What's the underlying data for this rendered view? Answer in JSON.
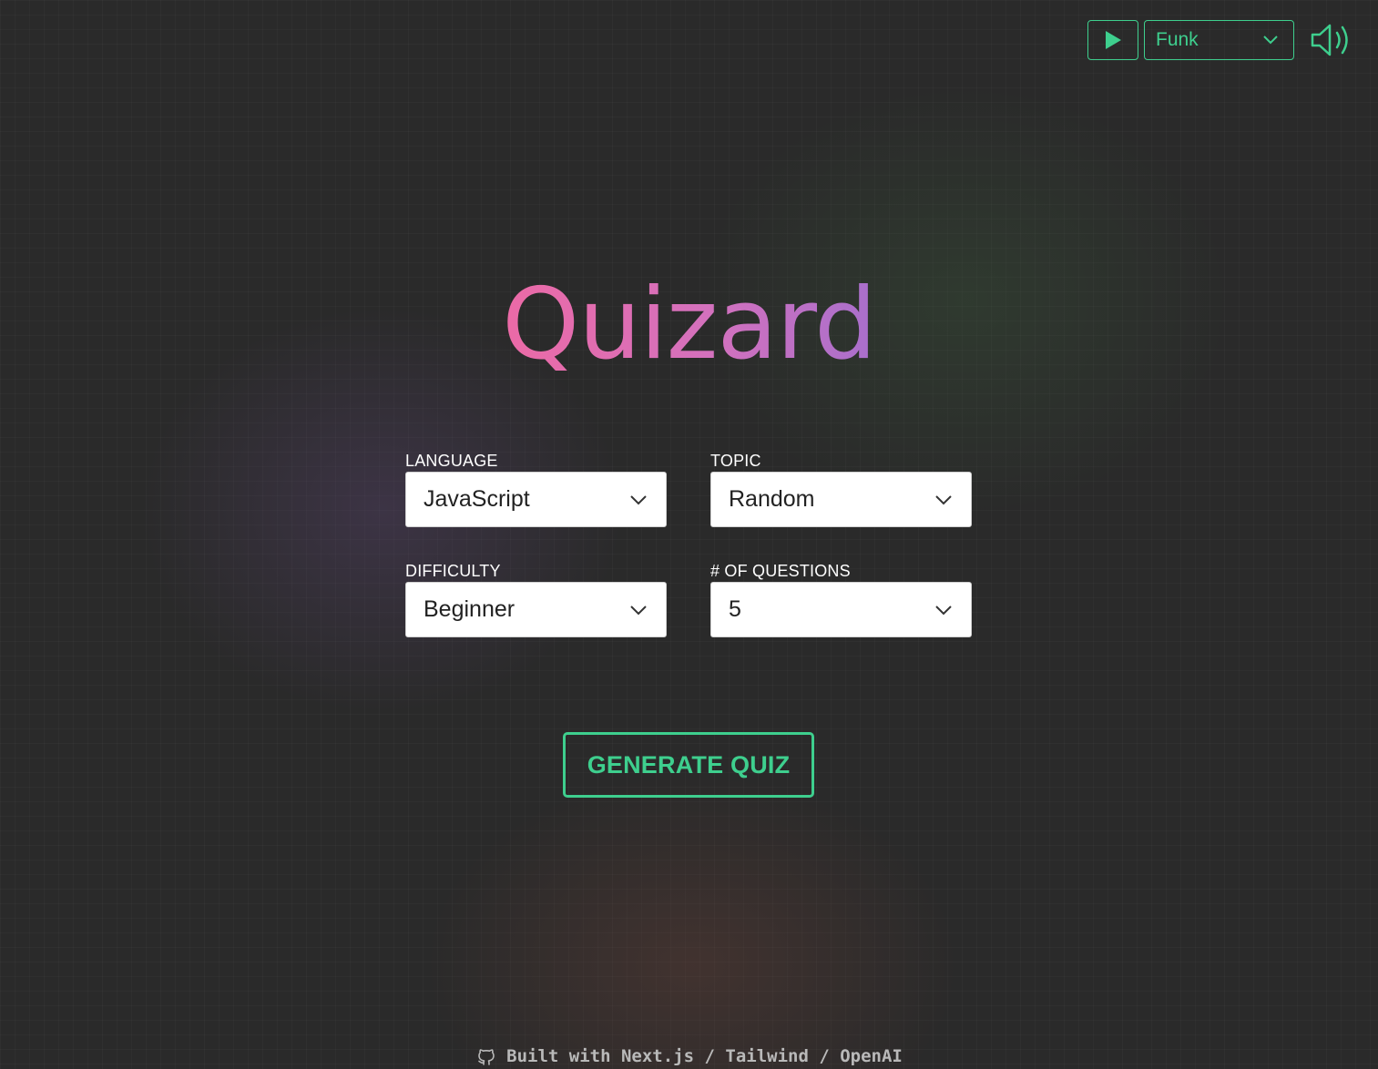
{
  "music": {
    "genre": "Funk"
  },
  "title": "Quizard",
  "form": {
    "language": {
      "label": "LANGUAGE",
      "value": "JavaScript"
    },
    "topic": {
      "label": "TOPIC",
      "value": "Random"
    },
    "difficulty": {
      "label": "DIFFICULTY",
      "value": "Beginner"
    },
    "questions": {
      "label": "# OF QUESTIONS",
      "value": "5"
    }
  },
  "generate_label": "GENERATE QUIZ",
  "footer": {
    "text": "Built with Next.js / Tailwind / OpenAI"
  },
  "colors": {
    "accent": "#3ecf8e",
    "title_start": "#ec6aa6",
    "title_end": "#a86fcc",
    "background": "#2a2a2a"
  },
  "icons": [
    "play-icon",
    "chevron-down-icon",
    "volume-icon",
    "github-icon"
  ]
}
